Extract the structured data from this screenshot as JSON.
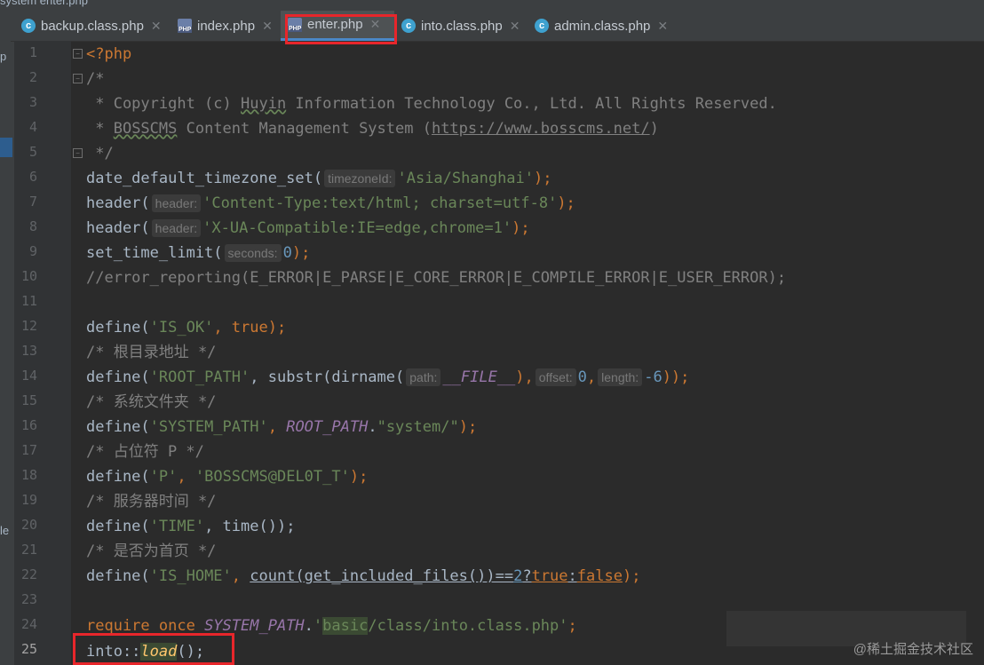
{
  "breadcrumb": {
    "text": "system  enter.php"
  },
  "tabs": [
    {
      "label": "backup.class.php",
      "icon": "class-c-icon",
      "active": false
    },
    {
      "label": "index.php",
      "icon": "php-file-icon",
      "active": false
    },
    {
      "label": "enter.php",
      "icon": "php-file-icon",
      "active": true
    },
    {
      "label": "into.class.php",
      "icon": "class-c-icon",
      "active": false
    },
    {
      "label": "admin.class.php",
      "icon": "class-c-icon",
      "active": false
    }
  ],
  "left_panel": {
    "label_top": "p",
    "label_bottom": "le"
  },
  "line_numbers": [
    "1",
    "2",
    "3",
    "4",
    "5",
    "6",
    "7",
    "8",
    "9",
    "10",
    "11",
    "12",
    "13",
    "14",
    "15",
    "16",
    "17",
    "18",
    "19",
    "20",
    "21",
    "22",
    "23",
    "24",
    "25"
  ],
  "code": {
    "l1": "<?php",
    "l2": "/*",
    "l3a": " * Copyright (c) ",
    "l3b": "Huyin",
    "l3c": " Information Technology Co., Ltd. All Rights Reserved.",
    "l4a": " * ",
    "l4b": "BOSSCMS",
    "l4c": " Content Management System (",
    "l4d": "https://www.bosscms.net/",
    "l4e": ")",
    "l5": " */",
    "l6a": "date_default_timezone_set(",
    "l6h": "timezoneId:",
    "l6s": "'Asia/Shanghai'",
    "l6e": ");",
    "l7a": "header(",
    "l7h": "header:",
    "l7s": "'Content-Type:text/html; charset=utf-8'",
    "l7e": ");",
    "l8a": "header(",
    "l8h": "header:",
    "l8s": "'X-UA-Compatible:IE=edge,chrome=1'",
    "l8e": ");",
    "l9a": "set_time_limit(",
    "l9h": "seconds:",
    "l9n": "0",
    "l9e": ");",
    "l10": "//error_reporting(E_ERROR|E_PARSE|E_CORE_ERROR|E_COMPILE_ERROR|E_USER_ERROR);",
    "l12a": "define(",
    "l12s": "'IS_OK'",
    "l12c": ", ",
    "l12k": "true",
    "l12e": ");",
    "l13": "/* 根目录地址 */",
    "l14a": "define(",
    "l14s": "'ROOT_PATH'",
    "l14b": ", substr(dirname(",
    "l14h1": "path:",
    "l14c": "__FILE__",
    "l14d": "),",
    "l14h2": "offset:",
    "l14n1": "0",
    "l14f": ",",
    "l14h3": "length:",
    "l14n2": "-6",
    "l14e": "));",
    "l15": "/* 系统文件夹 */",
    "l16a": "define(",
    "l16s": "'SYSTEM_PATH'",
    "l16b": ", ",
    "l16c": "ROOT_PATH",
    "l16d": ".",
    "l16s2": "\"system/\"",
    "l16e": ");",
    "l17": "/* 占位符 P */",
    "l18a": "define(",
    "l18s": "'P'",
    "l18b": ", ",
    "l18s2": "'BOSSCMS@DEL0T_T'",
    "l18e": ");",
    "l19": "/* 服务器时间 */",
    "l20a": "define(",
    "l20s": "'TIME'",
    "l20b": ", time());",
    "l21": "/* 是否为首页 */",
    "l22a": "define(",
    "l22s": "'IS_HOME'",
    "l22b": ", ",
    "l22c": "count(get_included_files())==",
    "l22n": "2",
    "l22q": "?",
    "l22k1": "true",
    "l22col": ":",
    "l22k2": "false",
    "l22e": ");",
    "l24a": "require_once ",
    "l24c": "SYSTEM_PATH",
    "l24d": ".",
    "l24s1": "'",
    "l24s2": "basic",
    "l24s3": "/class/into.class.php'",
    "l24e": ";",
    "l25a": "into::",
    "l25b": "load",
    "l25e": "();"
  },
  "watermark": "@稀土掘金技术社区",
  "colors": {
    "background": "#2b2b2b",
    "keyword": "#cc7832",
    "string": "#6a8759",
    "number": "#6897bb",
    "comment": "#808080",
    "constant": "#9876aa",
    "highlight_box": "#e8262b"
  }
}
